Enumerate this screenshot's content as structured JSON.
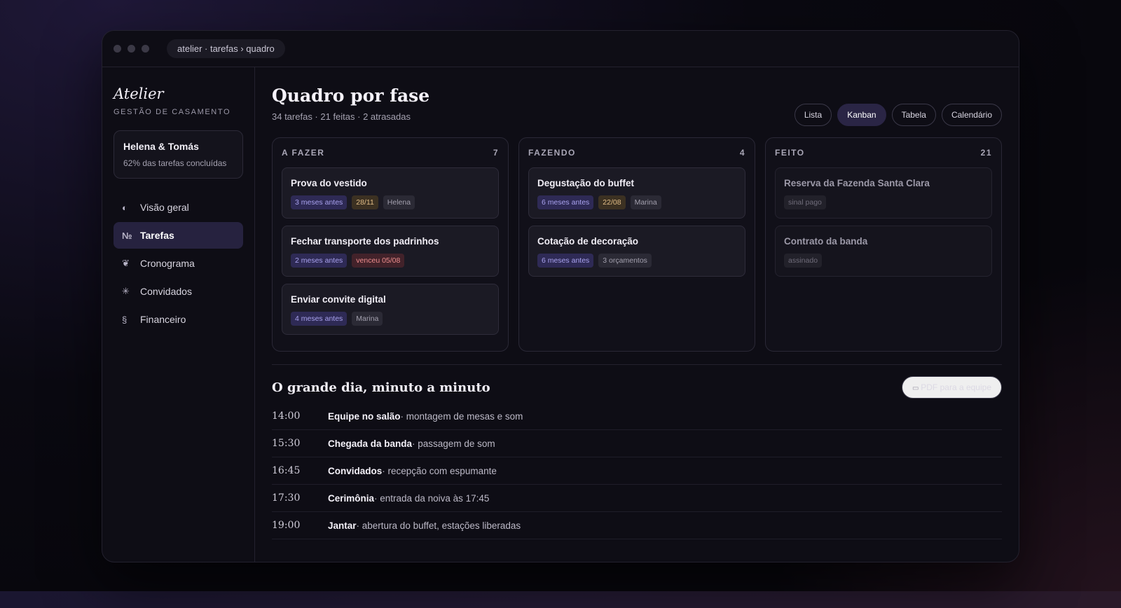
{
  "window": {
    "breadcrumb": "atelier · tarefas › quadro"
  },
  "sidebar": {
    "brand": "Atelier",
    "brand_sub": "GESTÃO DE CASAMENTO",
    "couple": {
      "name": "Helena & Tomás",
      "progress": "62% das tarefas concluídas"
    },
    "items": [
      {
        "icon": "◐",
        "label": "Visão geral"
      },
      {
        "icon": "№",
        "label": "Tarefas"
      },
      {
        "icon": "❦",
        "label": "Cronograma"
      },
      {
        "icon": "✳",
        "label": "Convidados"
      },
      {
        "icon": "§",
        "label": "Financeiro"
      }
    ]
  },
  "header": {
    "title": "Quadro por fase",
    "subtitle": "34 tarefas · 21 feitas · 2 atrasadas",
    "views": [
      "Lista",
      "Kanban",
      "Tabela",
      "Calendário"
    ]
  },
  "board": {
    "columns": [
      {
        "title": "A FAZER",
        "count": "7",
        "cards": [
          {
            "title": "Prova do vestido",
            "tags": [
              "3 meses antes",
              "28/11",
              "Helena"
            ]
          },
          {
            "title": "Fechar transporte dos padrinhos",
            "tags": [
              "2 meses antes",
              "venceu 05/08"
            ]
          },
          {
            "title": "Enviar convite digital",
            "tags": [
              "4 meses antes",
              "Marina"
            ]
          }
        ]
      },
      {
        "title": "FAZENDO",
        "count": "4",
        "cards": [
          {
            "title": "Degustação do buffet",
            "tags": [
              "6 meses antes",
              "22/08",
              "Marina"
            ]
          },
          {
            "title": "Cotação de decoração",
            "tags": [
              "6 meses antes",
              "3 orçamentos"
            ]
          }
        ]
      },
      {
        "title": "FEITO",
        "count": "21",
        "cards": [
          {
            "title": "Reserva da Fazenda Santa Clara",
            "tags": [
              "sinal pago"
            ]
          },
          {
            "title": "Contrato da banda",
            "tags": [
              "assinado"
            ]
          }
        ]
      }
    ]
  },
  "schedule": {
    "title": "O grande dia, minuto a minuto",
    "pdf_button": "PDF para a equipe",
    "rows": [
      {
        "time": "14:00",
        "title": "Equipe no salão",
        "desc": " · montagem de mesas e som"
      },
      {
        "time": "15:30",
        "title": "Chegada da banda",
        "desc": " · passagem de som"
      },
      {
        "time": "16:45",
        "title": "Convidados",
        "desc": " · recepção com espumante"
      },
      {
        "time": "17:30",
        "title": "Cerimônia",
        "desc": " · entrada da noiva às 17:45"
      },
      {
        "time": "19:00",
        "title": "Jantar",
        "desc": " · abertura do buffet, estações liberadas"
      }
    ]
  }
}
